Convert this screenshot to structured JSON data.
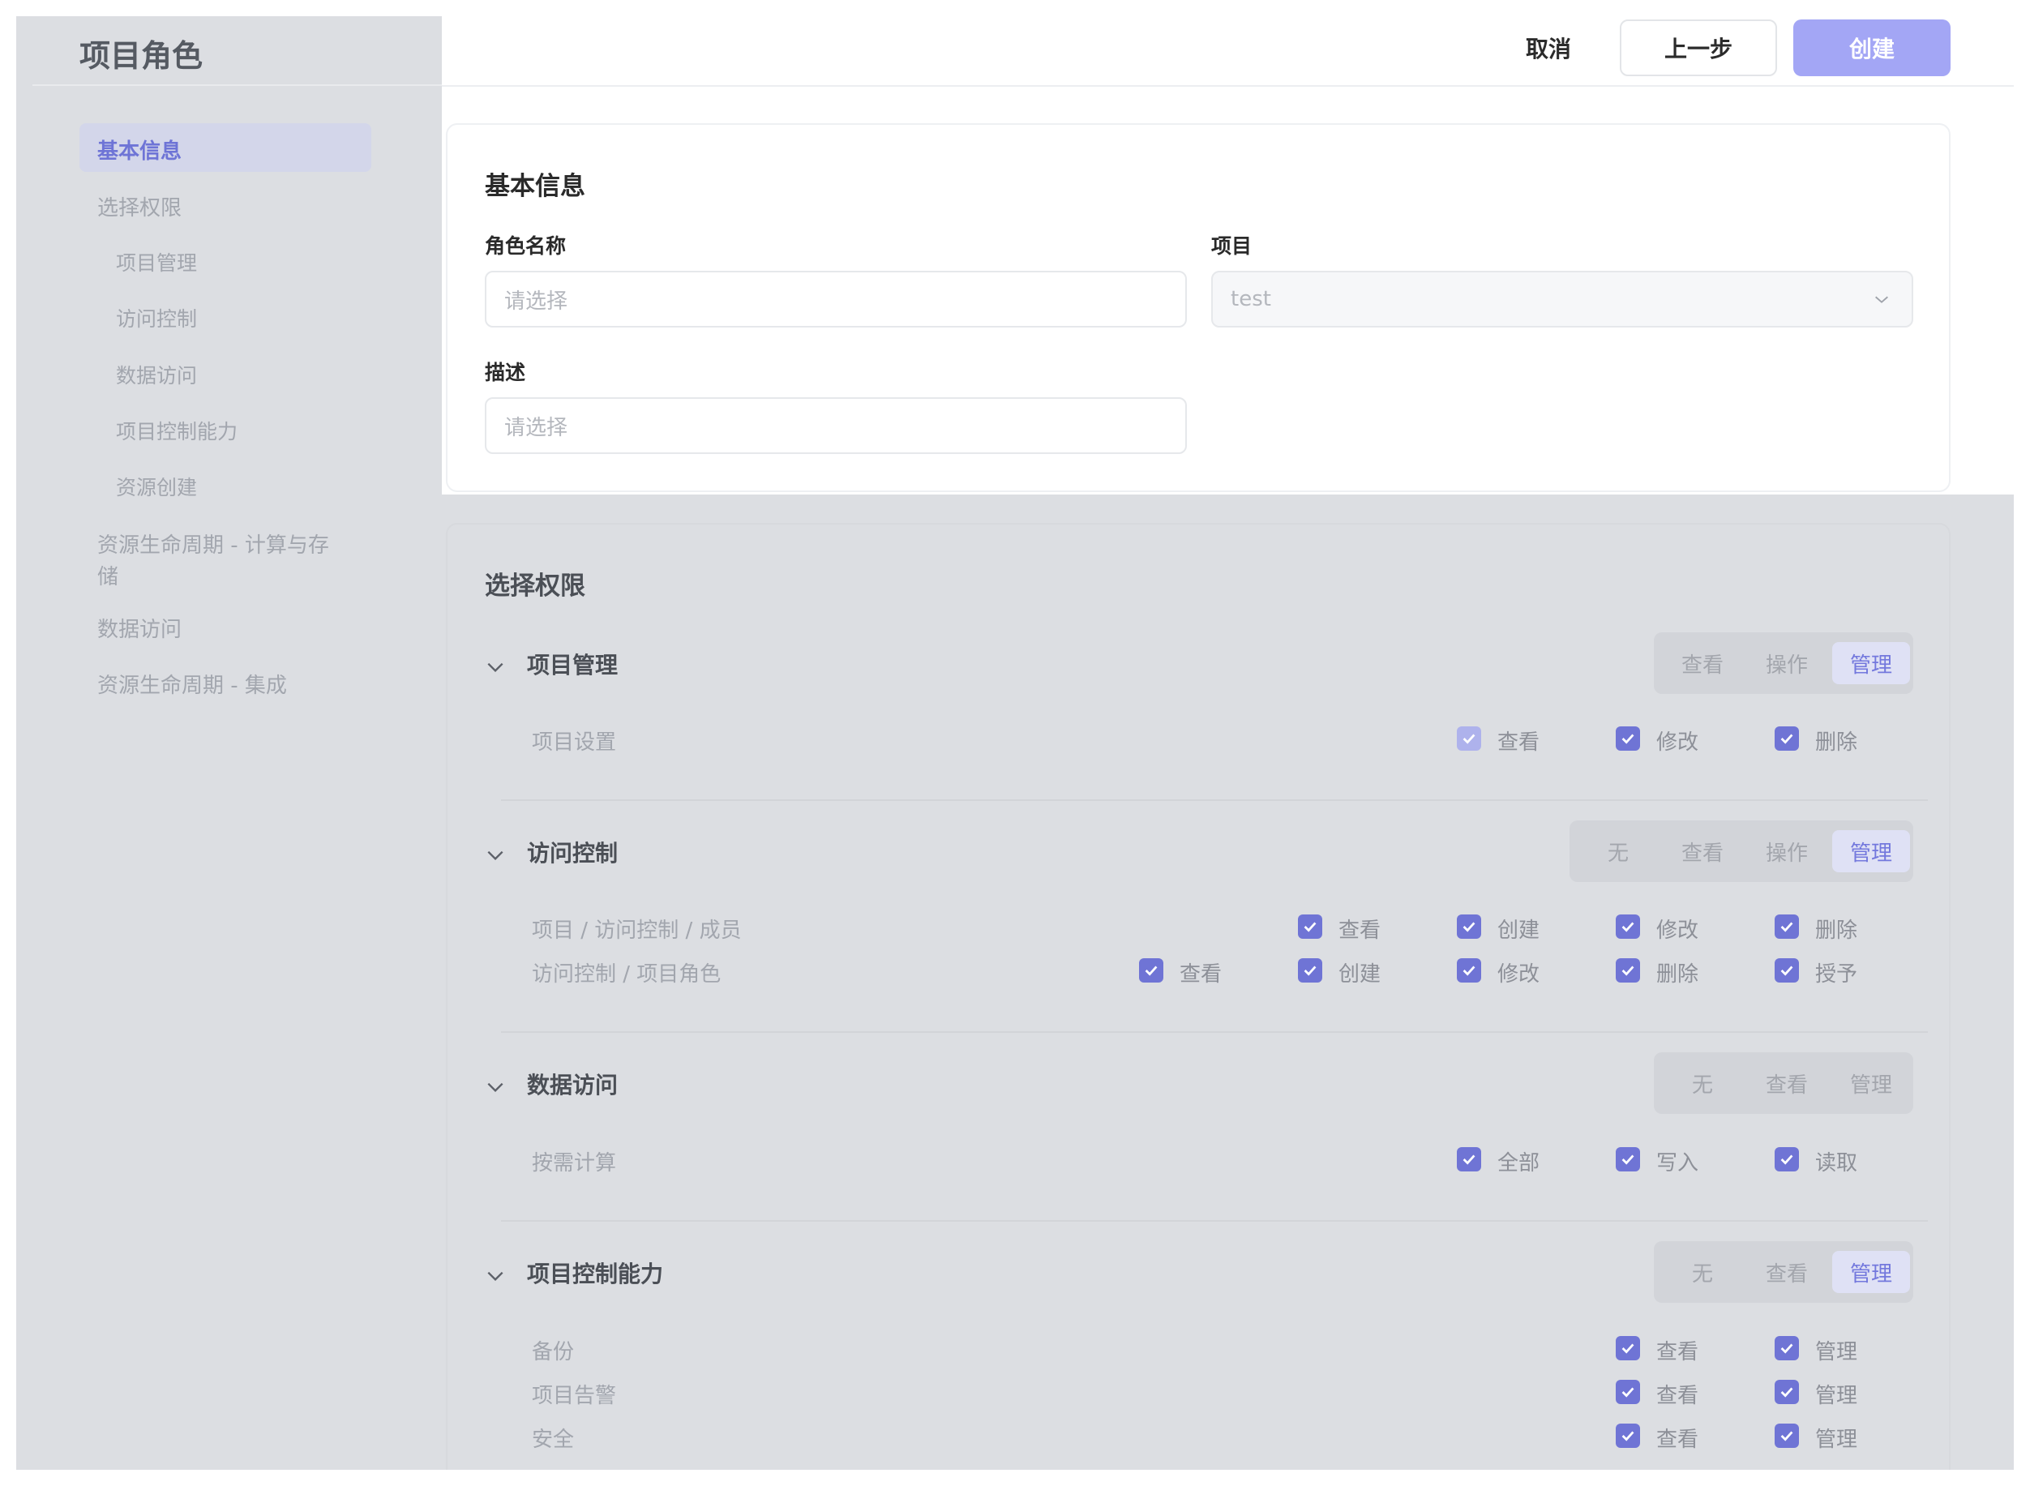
{
  "page": {
    "title": "项目角色"
  },
  "sidebar": {
    "items": [
      {
        "label": "基本信息",
        "active": true
      },
      {
        "label": "选择权限"
      },
      {
        "label": "项目管理"
      },
      {
        "label": "访问控制"
      },
      {
        "label": "数据访问"
      },
      {
        "label": "项目控制能力"
      },
      {
        "label": "资源创建"
      },
      {
        "label_line1": "资源生命周期 - 计算与存",
        "label_line2": "储"
      },
      {
        "label": "数据访问"
      },
      {
        "label": "资源生命周期 - 集成"
      }
    ]
  },
  "toolbar": {
    "cancel_label": "取消",
    "prev_label": "上一步",
    "create_label": "创建"
  },
  "basic_info": {
    "title": "基本信息",
    "role_name": {
      "label": "角色名称",
      "placeholder": "请选择"
    },
    "project": {
      "label": "项目",
      "value": "test"
    },
    "description": {
      "label": "描述",
      "placeholder": "请选择"
    }
  },
  "permissions": {
    "title": "选择权限",
    "sections": [
      {
        "title": "项目管理",
        "levels": [
          "查看",
          "操作",
          "管理"
        ],
        "selected": "管理",
        "rows": [
          {
            "label": "项目设置",
            "options": [
              "查看",
              "修改",
              "删除"
            ]
          }
        ]
      },
      {
        "title": "访问控制",
        "levels": [
          "无",
          "查看",
          "操作",
          "管理"
        ],
        "selected": "管理",
        "rows": [
          {
            "label": "项目 / 访问控制 / 成员",
            "options": [
              "查看",
              "创建",
              "修改",
              "删除"
            ]
          },
          {
            "label": "访问控制 / 项目角色",
            "options": [
              "查看",
              "创建",
              "修改",
              "删除",
              "授予"
            ]
          }
        ]
      },
      {
        "title": "数据访问",
        "levels": [
          "无",
          "查看",
          "管理"
        ],
        "selected": null,
        "rows": [
          {
            "label": "按需计算",
            "options": [
              "全部",
              "写入",
              "读取"
            ]
          }
        ]
      },
      {
        "title": "项目控制能力",
        "levels": [
          "无",
          "查看",
          "管理"
        ],
        "selected": "管理",
        "rows": [
          {
            "label": "备份",
            "options": [
              "查看",
              "管理"
            ]
          },
          {
            "label": "项目告警",
            "options": [
              "查看",
              "管理"
            ]
          },
          {
            "label": "安全",
            "options": [
              "查看",
              "管理"
            ]
          }
        ]
      }
    ]
  },
  "colors": {
    "accent": "#6f74d5",
    "accent_light": "#a3a6f5",
    "overlay": "#dcdee2"
  }
}
